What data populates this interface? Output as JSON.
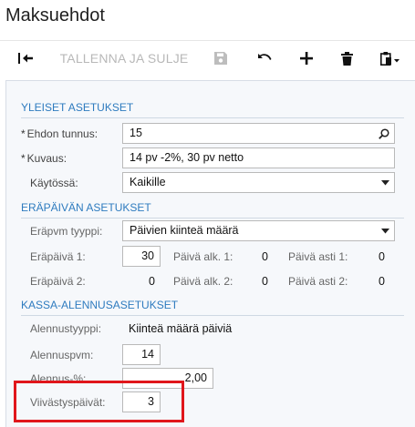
{
  "page": {
    "title": "Maksuehdot"
  },
  "toolbar": {
    "save_close_label": "TALLENNA JA SULJE"
  },
  "general": {
    "heading": "YLEISET ASETUKSET",
    "term_id_label": "Ehdon tunnus:",
    "term_id_value": "15",
    "description_label": "Kuvaus:",
    "description_value": "14 pv -2%, 30 pv netto",
    "usage_label": "Käytössä:",
    "usage_value": "Kaikille",
    "required_mark": "*"
  },
  "due_date": {
    "heading": "ERÄPÄIVÄN ASETUKSET",
    "type_label": "Eräpvm tyyppi:",
    "type_value": "Päivien kiinteä määrä",
    "due1_label": "Eräpäivä 1:",
    "due1_value": "30",
    "day_start1_label": "Päivä alk. 1:",
    "day_start1_value": "0",
    "day_end1_label": "Päivä asti 1:",
    "day_end1_value": "0",
    "due2_label": "Eräpäivä 2:",
    "due2_value": "0",
    "day_start2_label": "Päivä alk. 2:",
    "day_start2_value": "0",
    "day_end2_label": "Päivä asti 2:",
    "day_end2_value": "0"
  },
  "discount": {
    "heading": "KASSA-ALENNUSASETUKSET",
    "type_label": "Alennustyyppi:",
    "type_value": "Kiinteä määrä päiviä",
    "date_label": "Alennuspvm:",
    "date_value": "14",
    "percent_label": "Alennus-%:",
    "percent_value": "2,00",
    "delay_label": "Viivästyspäivät:",
    "delay_value": "3"
  },
  "colors": {
    "accent": "#2e7bbf",
    "highlight": "#e0161b"
  }
}
